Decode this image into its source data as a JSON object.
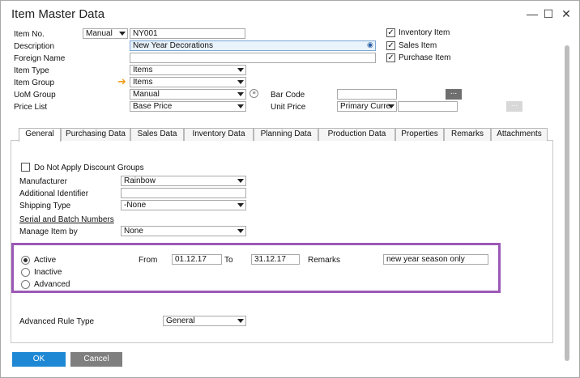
{
  "window": {
    "title": "Item Master Data"
  },
  "header": {
    "item_no_label": "Item No.",
    "item_no_series": "Manual",
    "item_no_value": "NY001",
    "description_label": "Description",
    "description_value": "New Year Decorations",
    "foreign_name_label": "Foreign Name",
    "foreign_name_value": "",
    "item_type_label": "Item Type",
    "item_type_value": "Items",
    "item_group_label": "Item Group",
    "item_group_value": "Items",
    "uom_group_label": "UoM Group",
    "uom_group_value": "Manual",
    "price_list_label": "Price List",
    "price_list_value": "Base Price",
    "bar_code_label": "Bar Code",
    "bar_code_value": "",
    "unit_price_label": "Unit Price",
    "unit_price_currency": "Primary Curre",
    "unit_price_value": "",
    "inventory_item_label": "Inventory Item",
    "sales_item_label": "Sales Item",
    "purchase_item_label": "Purchase Item",
    "check_mark": "✓"
  },
  "tabs": [
    {
      "label": "General"
    },
    {
      "label": "Purchasing Data"
    },
    {
      "label": "Sales Data"
    },
    {
      "label": "Inventory Data"
    },
    {
      "label": "Planning Data"
    },
    {
      "label": "Production Data"
    },
    {
      "label": "Properties"
    },
    {
      "label": "Remarks"
    },
    {
      "label": "Attachments"
    }
  ],
  "general": {
    "no_discount_label": "Do Not Apply Discount Groups",
    "manufacturer_label": "Manufacturer",
    "manufacturer_value": "Rainbow",
    "additional_id_label": "Additional Identifier",
    "additional_id_value": "",
    "shipping_type_label": "Shipping Type",
    "shipping_type_value": "-None",
    "serial_batch_label": "Serial and Batch Numbers",
    "manage_item_label": "Manage Item by",
    "manage_item_value": "None",
    "active_label": "Active",
    "inactive_label": "Inactive",
    "advanced_label": "Advanced",
    "from_label": "From",
    "from_value": "01.12.17",
    "to_label": "To",
    "to_value": "31.12.17",
    "remarks_label": "Remarks",
    "remarks_value": "new year season only",
    "adv_rule_label": "Advanced Rule Type",
    "adv_rule_value": "General"
  },
  "footer": {
    "ok_label": "OK",
    "cancel_label": "Cancel"
  },
  "colors": {
    "accent": "#1f88d4",
    "highlight": "#9b59b6",
    "arrow": "#f0a020"
  }
}
